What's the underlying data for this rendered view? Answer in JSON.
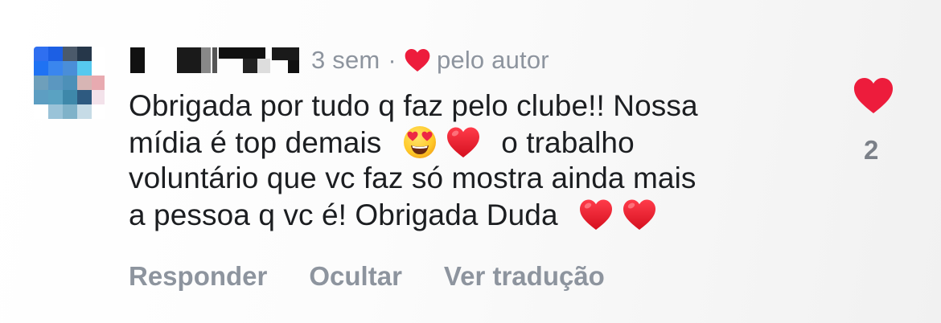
{
  "comment": {
    "time_ago": "3 sem",
    "separator": "·",
    "liked_by": "pelo autor",
    "text_line1": "Obrigada por tudo q faz pelo clube!! Nossa",
    "text_line2a": "mídia é top demais",
    "text_line2b": "o trabalho",
    "text_line3": "voluntário que vc faz só mostra ainda mais",
    "text_line4": "a pessoa q vc é! Obrigada Duda",
    "emoji_1": "smiling-face-with-heart-eyes",
    "emoji_2": "red-heart",
    "emoji_3": "red-heart",
    "emoji_4": "red-heart"
  },
  "actions": {
    "reply": "Responder",
    "hide": "Ocultar",
    "translate": "Ver tradução"
  },
  "likes": {
    "count": "2",
    "heart_color": "#ed1c3c"
  },
  "colors": {
    "meta_text": "#8d949e",
    "body_text": "#1c1e21",
    "heart_red": "#ed1c3c"
  }
}
